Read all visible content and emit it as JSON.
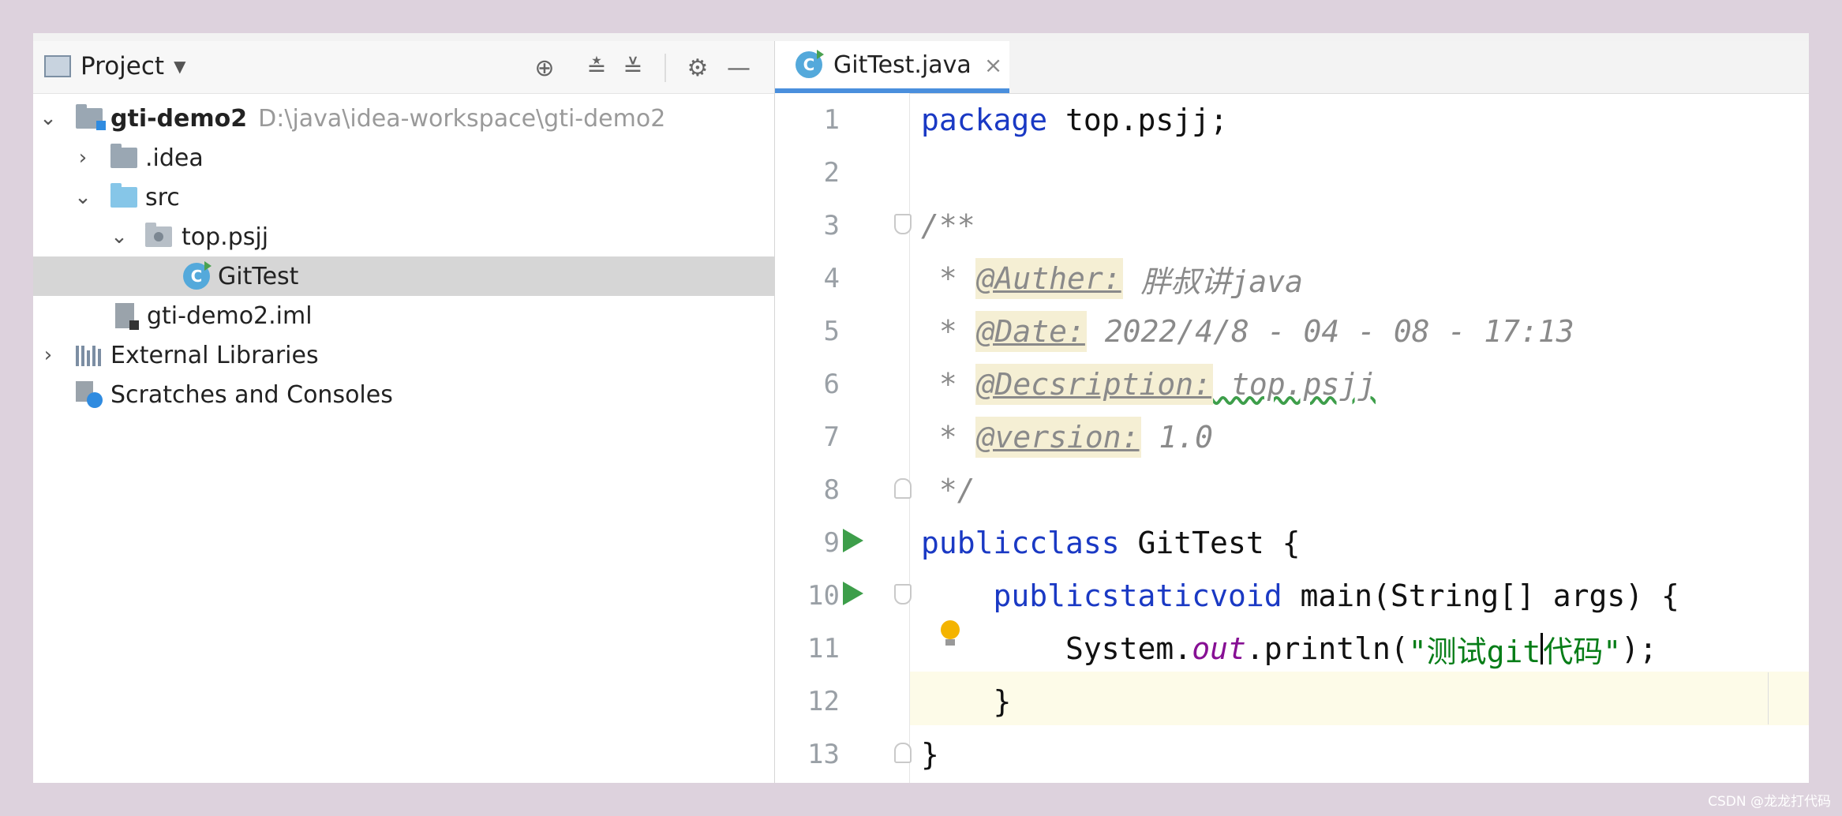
{
  "project_panel": {
    "title": "Project",
    "tree": [
      {
        "label": "gti-demo2",
        "path": "D:\\java\\idea-workspace\\gti-demo2"
      },
      {
        "label": ".idea"
      },
      {
        "label": "src"
      },
      {
        "label": "top.psjj"
      },
      {
        "label": "GitTest",
        "selected": true
      },
      {
        "label": "gti-demo2.iml"
      },
      {
        "label": "External Libraries"
      },
      {
        "label": "Scratches and Consoles"
      }
    ],
    "icons": [
      "locate-icon",
      "expand-all-icon",
      "collapse-all-icon",
      "gear-icon",
      "minimize-icon"
    ]
  },
  "editor": {
    "tab": {
      "icon_letter": "C",
      "label": "GitTest.java",
      "close": "×"
    },
    "lines": [
      {
        "num": "1",
        "kw": "package",
        "rest": " top.psjj;"
      },
      {
        "num": "2"
      },
      {
        "num": "3",
        "comment": "/**"
      },
      {
        "num": "4",
        "prefix": " * ",
        "tag": "@Auther:",
        "value": " 胖叔讲java"
      },
      {
        "num": "5",
        "prefix": " * ",
        "tag": "@Date:",
        "value": " 2022/4/8 - 04 - 08 - 17:13"
      },
      {
        "num": "6",
        "prefix": " * ",
        "tag": "@Decsription:",
        "value": " top.psjj"
      },
      {
        "num": "7",
        "prefix": " * ",
        "tag": "@version:",
        "value": " 1.0"
      },
      {
        "num": "8",
        "comment": " */"
      },
      {
        "num": "9",
        "kw1": "public",
        "kw2": "class",
        "rest": " GitTest {"
      },
      {
        "num": "10",
        "indent": "    ",
        "kw1": "public",
        "kw2": "static",
        "kw3": "void",
        "rest": " main(String[] args) {"
      },
      {
        "num": "11",
        "indent": "        ",
        "obj": "System.",
        "field": "out",
        "call": ".println(",
        "str_a": "\"测试git",
        "str_b": "代码\"",
        "end": ");"
      },
      {
        "num": "12",
        "rest": "    }"
      },
      {
        "num": "13",
        "rest": "}"
      }
    ]
  },
  "watermark": "CSDN @龙龙打代码",
  "colors": {
    "keyword": "#1a39c4",
    "string": "#067d17",
    "field": "#871094",
    "comment": "#8a8a8a",
    "run": "#3d9e4a",
    "selection": "#d6d6d6",
    "tab_underline": "#4a8fdd"
  }
}
